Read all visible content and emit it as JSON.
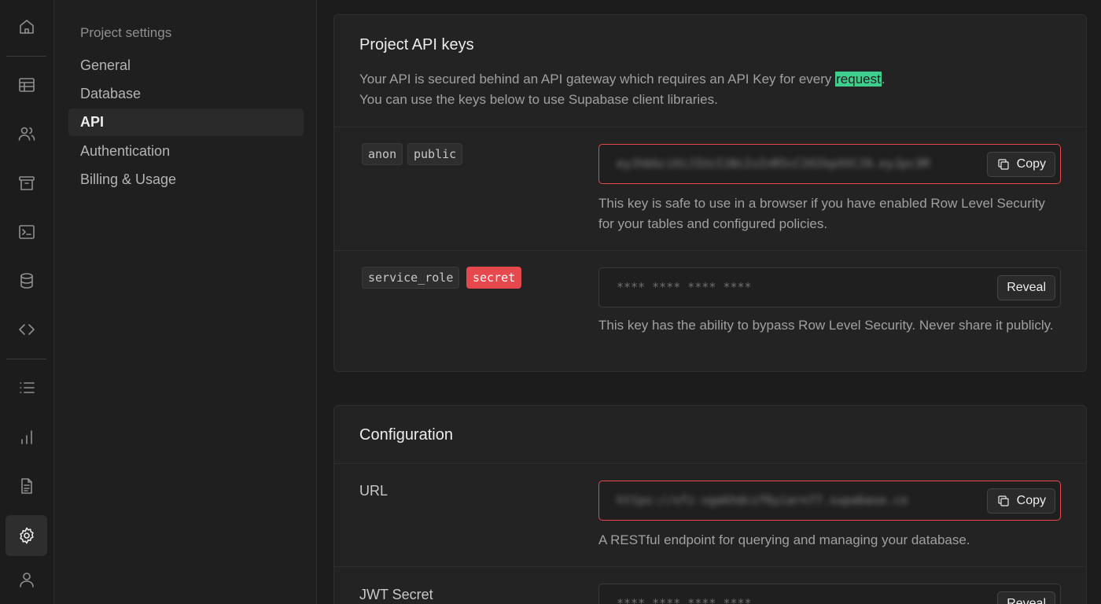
{
  "menu": {
    "heading": "Project settings",
    "items": [
      {
        "label": "General"
      },
      {
        "label": "Database"
      },
      {
        "label": "API"
      },
      {
        "label": "Authentication"
      },
      {
        "label": "Billing & Usage"
      }
    ]
  },
  "api_keys": {
    "title": "Project API keys",
    "description_before": "Your API is secured behind an API gateway which requires an API Key for every ",
    "description_highlight": "request",
    "description_after": ".",
    "description_line2": "You can use the keys below to use Supabase client libraries.",
    "anon": {
      "tags": [
        "anon",
        "public"
      ],
      "key_value": "eyJhbGciOiJIUzI1NiIsInR5cCI6IkpXVCJ9.eyJpc3M",
      "button": "Copy",
      "help": "This key is safe to use in a browser if you have enabled Row Level Security for your tables and configured policies."
    },
    "service": {
      "tags": [
        "service_role",
        "secret"
      ],
      "key_value": "**** **** **** ****",
      "button": "Reveal",
      "help": "This key has the ability to bypass Row Level Security. Never share it publicly."
    }
  },
  "configuration": {
    "title": "Configuration",
    "url": {
      "label": "URL",
      "value": "https://xfz-xgakhdczf6yiarn77.supabase.co",
      "button": "Copy",
      "help": "A RESTful endpoint for querying and managing your database."
    },
    "jwt": {
      "label": "JWT Secret",
      "value": "**** **** **** ****",
      "button": "Reveal"
    }
  },
  "colors": {
    "accent": "#3ecf8e",
    "danger": "#e5484d",
    "background": "#1c1c1c"
  }
}
